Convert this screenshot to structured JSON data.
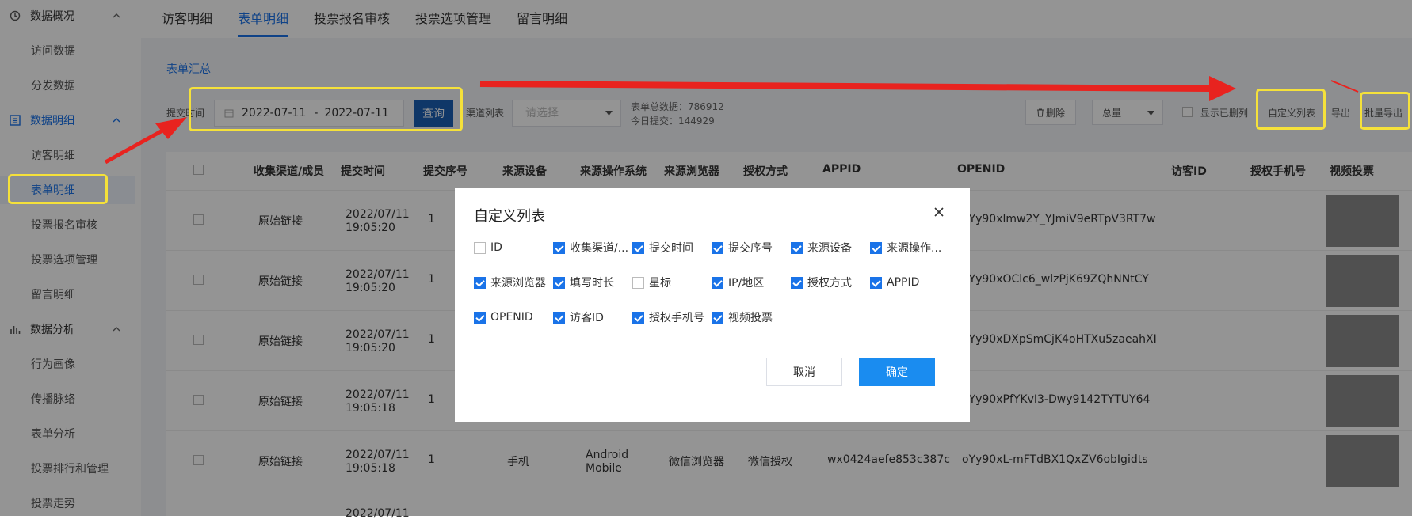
{
  "sidebar": {
    "groups": [
      {
        "label": "数据概况",
        "icon": "clock-icon"
      },
      {
        "label": "数据明细",
        "icon": "list-icon"
      },
      {
        "label": "数据分析",
        "icon": "bar-chart-icon"
      }
    ],
    "items": [
      {
        "label": "访问数据"
      },
      {
        "label": "分发数据"
      },
      {
        "label": "访客明细"
      },
      {
        "label": "表单明细"
      },
      {
        "label": "投票报名审核"
      },
      {
        "label": "投票选项管理"
      },
      {
        "label": "留言明细"
      },
      {
        "label": "行为画像"
      },
      {
        "label": "传播脉络"
      },
      {
        "label": "表单分析"
      },
      {
        "label": "投票排行和管理"
      },
      {
        "label": "投票走势"
      }
    ]
  },
  "tabs": [
    {
      "label": "访客明细"
    },
    {
      "label": "表单明细"
    },
    {
      "label": "投票报名审核"
    },
    {
      "label": "投票选项管理"
    },
    {
      "label": "留言明细"
    }
  ],
  "section_title": "表单汇总",
  "filters": {
    "submit_time_label": "提交时间",
    "date_start": "2022-07-11",
    "date_sep": "-",
    "date_end": "2022-07-11",
    "query_label": "查询",
    "channel_label": "渠道列表",
    "channel_placeholder": "请选择",
    "total_label": "表单总数据：786912",
    "today_label": "今日提交：144929"
  },
  "toolbar": {
    "delete_label": "删除",
    "summary_select": "总量",
    "show_deleted_label": "显示已删列",
    "custom_columns_label": "自定义列表",
    "export_label": "导出",
    "batch_export_label": "批量导出"
  },
  "table": {
    "headers": [
      "收集渠道/成员",
      "提交时间",
      "提交序号",
      "来源设备",
      "来源操作系统",
      "来源浏览器",
      "授权方式",
      "APPID",
      "OPENID",
      "访客ID",
      "授权手机号",
      "视频投票"
    ],
    "rows": [
      {
        "channel": "原始链接",
        "date": "2022/07/11",
        "time": "19:05:20",
        "seq": "1",
        "openid": "oYy90xlmw2Y_YJmiV9eRTpV3RT7w"
      },
      {
        "channel": "原始链接",
        "date": "2022/07/11",
        "time": "19:05:20",
        "seq": "1",
        "openid": "oYy90xOClc6_wlzPjK69ZQhNNtCY"
      },
      {
        "channel": "原始链接",
        "date": "2022/07/11",
        "time": "19:05:20",
        "seq": "1",
        "openid": "oYy90xDXpSmCjK4oHTXu5zaeahXI"
      },
      {
        "channel": "原始链接",
        "date": "2022/07/11",
        "time": "19:05:18",
        "seq": "1",
        "openid": "oYy90xPfYKvI3-Dwy9142TYTUY64"
      },
      {
        "channel": "原始链接",
        "date": "2022/07/11",
        "time": "19:05:18",
        "seq": "1",
        "device": "手机",
        "os_line1": "Android",
        "os_line2": "Mobile",
        "browser": "微信浏览器",
        "auth": "微信授权",
        "appid": "wx0424aefe853c387c",
        "openid": "oYy90xL-mFTdBX1QxZV6obIgidts"
      }
    ],
    "partial_row_date": "2022/07/11"
  },
  "modal": {
    "title": "自定义列表",
    "options": [
      {
        "label": "ID",
        "checked": false
      },
      {
        "label": "收集渠道/...",
        "checked": true
      },
      {
        "label": "提交时间",
        "checked": true
      },
      {
        "label": "提交序号",
        "checked": true
      },
      {
        "label": "来源设备",
        "checked": true
      },
      {
        "label": "来源操作...",
        "checked": true
      },
      {
        "label": "来源浏览器",
        "checked": true
      },
      {
        "label": "填写时长",
        "checked": true
      },
      {
        "label": "星标",
        "checked": false
      },
      {
        "label": "IP/地区",
        "checked": true
      },
      {
        "label": "授权方式",
        "checked": true
      },
      {
        "label": "APPID",
        "checked": true
      },
      {
        "label": "OPENID",
        "checked": true
      },
      {
        "label": "访客ID",
        "checked": true
      },
      {
        "label": "授权手机号",
        "checked": true
      },
      {
        "label": "视频投票",
        "checked": true
      }
    ],
    "cancel_label": "取消",
    "confirm_label": "确定"
  },
  "colors": {
    "accent": "#1a73e8",
    "annotation_box": "#f5e13a",
    "annotation_arrow": "#e8231f",
    "confirm_button": "#1a8cf0"
  }
}
